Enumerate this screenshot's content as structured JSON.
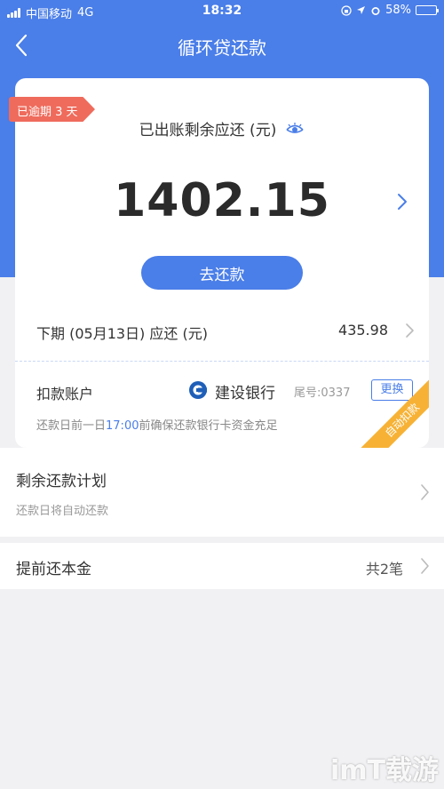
{
  "status_bar": {
    "carrier": "中国移动",
    "network": "4G",
    "time": "18:32",
    "battery": "58%",
    "battery_level": 0.58
  },
  "nav": {
    "title": "循环贷还款",
    "back_icon": "chevron-left-icon"
  },
  "overdue_tag": "已逾期 3 天",
  "bill": {
    "label": "已出账剩余应还 (元)",
    "amount": "1402.15",
    "pay_button": "去还款"
  },
  "next_period": {
    "label": "下期 (05月13日) 应还 (元)",
    "amount": "435.98"
  },
  "account": {
    "label": "扣款账户",
    "bank_name": "建设银行",
    "tail_number": "尾号:0337",
    "change_button": "更换",
    "note_prefix": "还款日前一日",
    "note_time": "17:00",
    "note_suffix": "前确保还款银行卡资金充足",
    "ribbon": "自动扣款"
  },
  "plan": {
    "title": "剩余还款计划",
    "subtitle": "还款日将自动还款"
  },
  "prepay": {
    "title": "提前还本金",
    "count": "共2笔"
  },
  "watermark": "imT载游",
  "colors": {
    "brand_blue": "#4a7ee8",
    "overdue_red": "#ef6b5c",
    "ribbon_orange": "#f7b236",
    "page_bg": "#f1f1f3"
  }
}
